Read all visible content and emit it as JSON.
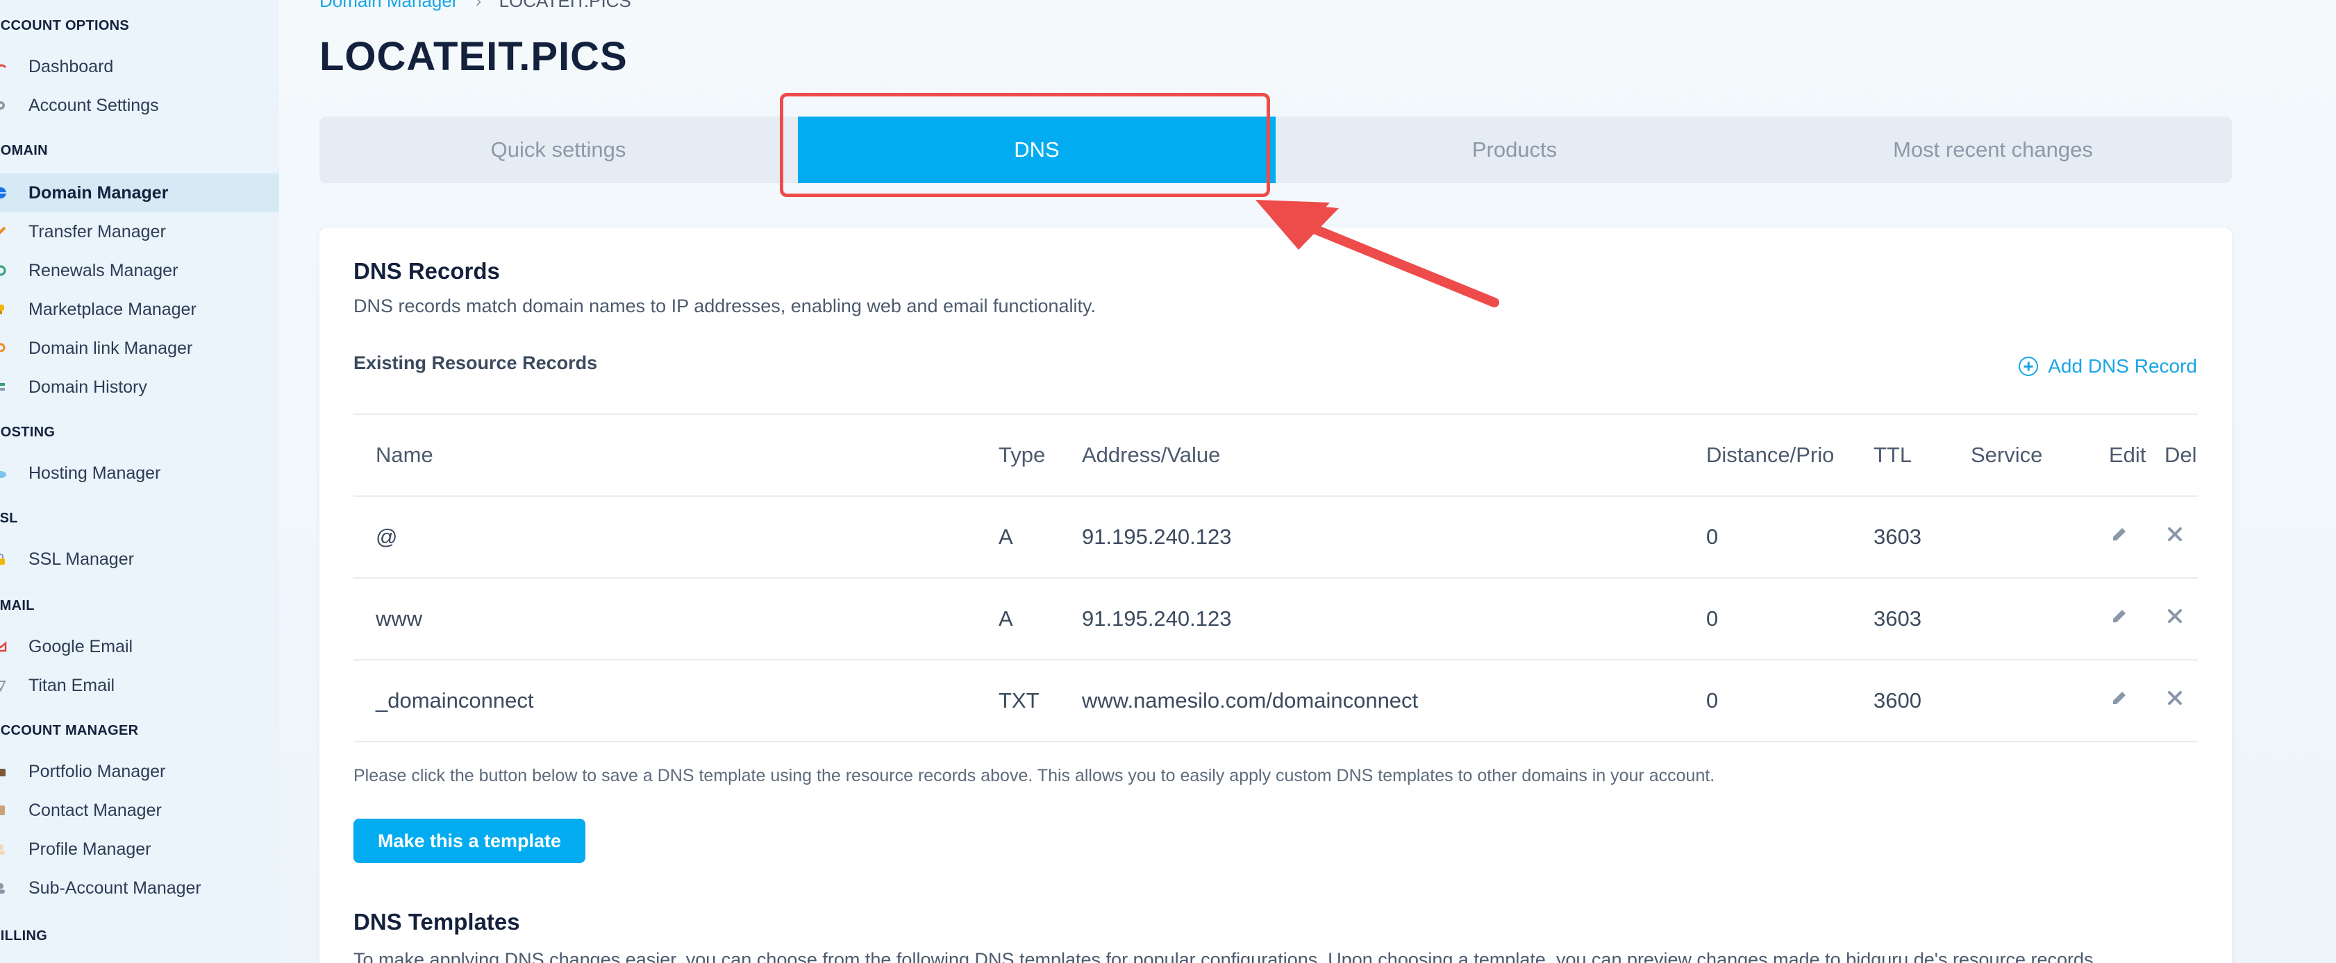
{
  "sidebar": {
    "sections": {
      "account_options": "ACCOUNT OPTIONS",
      "domain": "DOMAIN",
      "hosting": "HOSTING",
      "ssl": "SSL",
      "email": "EMAIL",
      "account_manager": "ACCOUNT MANAGER",
      "billing": "BILLING"
    },
    "items": {
      "dashboard": "Dashboard",
      "account_settings": "Account Settings",
      "domain_manager": "Domain Manager",
      "transfer_manager": "Transfer Manager",
      "renewals_manager": "Renewals Manager",
      "marketplace_manager": "Marketplace Manager",
      "domain_link_manager": "Domain link Manager",
      "domain_history": "Domain History",
      "hosting_manager": "Hosting Manager",
      "ssl_manager": "SSL Manager",
      "google_email": "Google Email",
      "titan_email": "Titan Email",
      "portfolio_manager": "Portfolio Manager",
      "contact_manager": "Contact Manager",
      "profile_manager": "Profile Manager",
      "sub_account_manager": "Sub-Account Manager"
    }
  },
  "breadcrumb": {
    "parent": "Domain Manager",
    "separator": "›",
    "current": "LOCATEIT.PICS"
  },
  "page_title": "LOCATEIT.PICS",
  "tabs": {
    "quick_settings": "Quick settings",
    "dns": "DNS",
    "products": "Products",
    "recent_changes": "Most recent changes"
  },
  "dns": {
    "title": "DNS Records",
    "description": "DNS records match domain names to IP addresses, enabling web and email functionality.",
    "existing_label": "Existing Resource Records",
    "add_record": "Add DNS Record",
    "columns": {
      "name": "Name",
      "type": "Type",
      "address": "Address/Value",
      "prio": "Distance/Prio",
      "ttl": "TTL",
      "service": "Service",
      "edit": "Edit",
      "del": "Del"
    },
    "rows": [
      {
        "name": "@",
        "type": "A",
        "address": "91.195.240.123",
        "prio": "0",
        "ttl": "3603",
        "service": ""
      },
      {
        "name": "www",
        "type": "A",
        "address": "91.195.240.123",
        "prio": "0",
        "ttl": "3603",
        "service": ""
      },
      {
        "name": "_domainconnect",
        "type": "TXT",
        "address": "www.namesilo.com/domainconnect",
        "prio": "0",
        "ttl": "3600",
        "service": ""
      }
    ],
    "template_note": "Please click the button below to save a DNS template using the resource records above. This allows you to easily apply custom DNS templates to other domains in your account.",
    "template_button": "Make this a template"
  },
  "templates": {
    "title": "DNS Templates",
    "description": "To make applying DNS changes easier, you can choose from the following DNS templates for popular configurations. Upon choosing a template, you can preview changes made to bidguru.de's resource records."
  },
  "colors": {
    "accent": "#03acf0",
    "highlight": "#ee4b4b",
    "title": "#14213d"
  }
}
